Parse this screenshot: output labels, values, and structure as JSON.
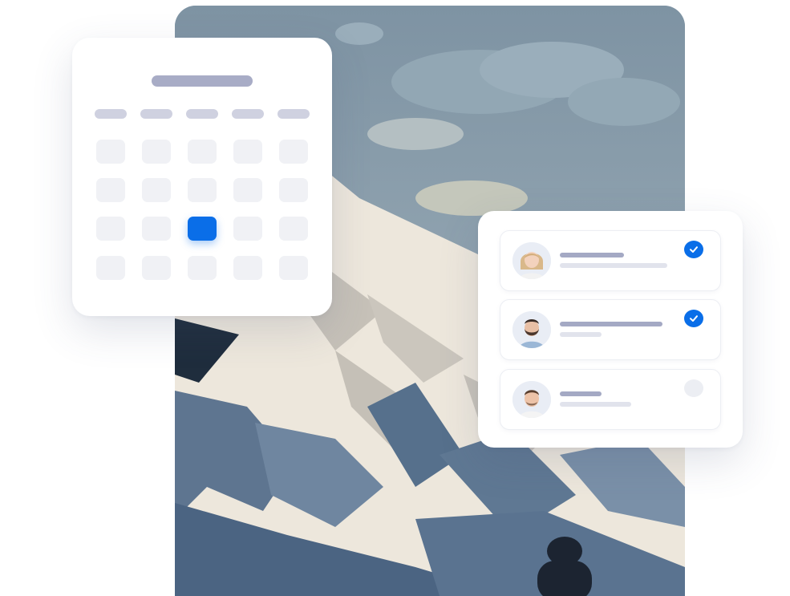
{
  "illustration": {
    "subject": "mountain-landscape-icon"
  },
  "calendar": {
    "columns": 5,
    "rows": 4,
    "selected_cell": {
      "row": 3,
      "col": 3
    },
    "accent_color": "#0a6ee8"
  },
  "team": {
    "members": [
      {
        "avatar": "woman-avatar-icon",
        "checked": true
      },
      {
        "avatar": "bearded-man-avatar-icon",
        "checked": true
      },
      {
        "avatar": "man-avatar-icon",
        "checked": false
      }
    ],
    "check_color": "#0a6ee8"
  }
}
